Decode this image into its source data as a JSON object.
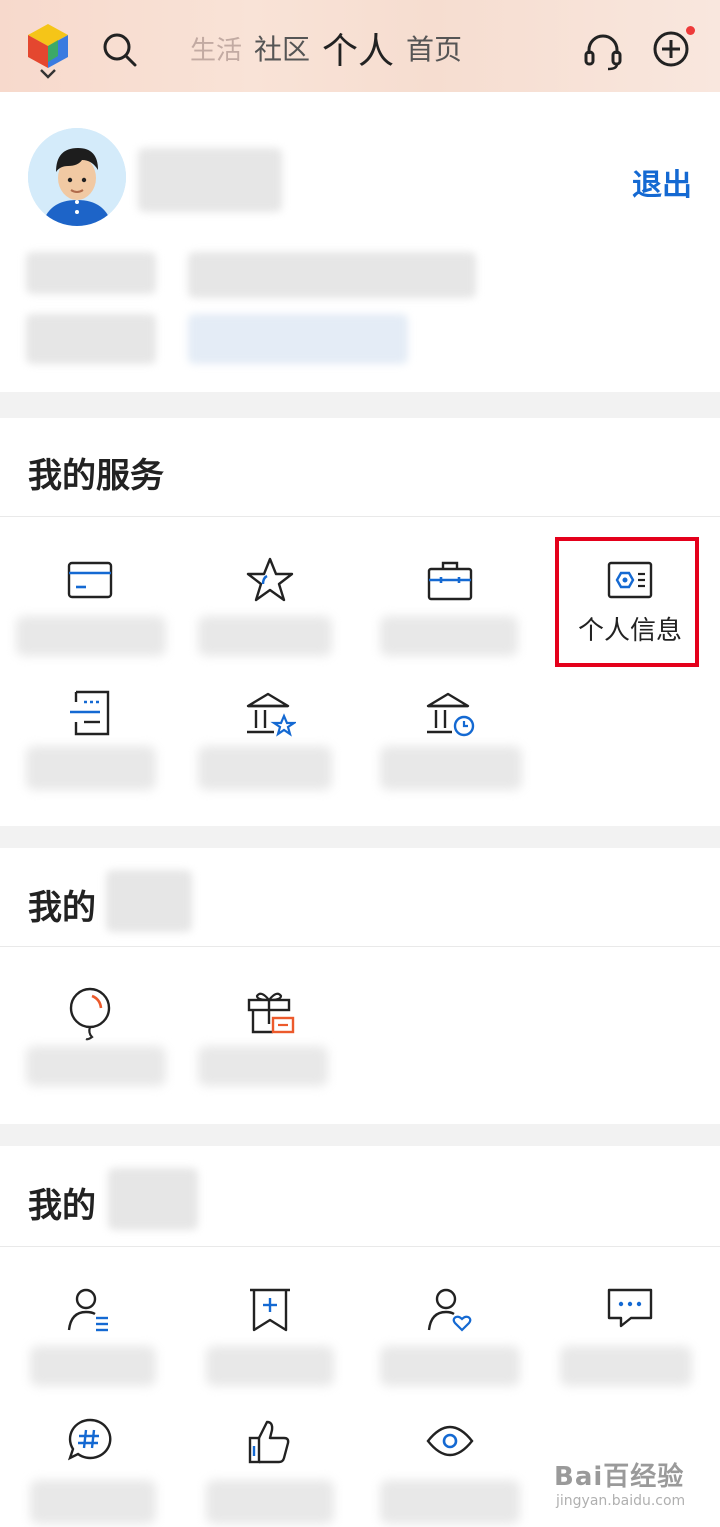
{
  "header": {
    "tabs": [
      {
        "label": "生活"
      },
      {
        "label": "社区"
      },
      {
        "label": "个人"
      },
      {
        "label": "首页"
      }
    ]
  },
  "profile": {
    "logout_label": "退出"
  },
  "my_services": {
    "title": "我的服务",
    "items": [
      {
        "icon": "card-icon",
        "label": ""
      },
      {
        "icon": "star-icon",
        "label": ""
      },
      {
        "icon": "briefcase-icon",
        "label": ""
      },
      {
        "icon": "id-card-icon",
        "label": "个人信息"
      },
      {
        "icon": "list-icon",
        "label": ""
      },
      {
        "icon": "bank-star-icon",
        "label": ""
      },
      {
        "icon": "bank-clock-icon",
        "label": ""
      }
    ]
  },
  "section2": {
    "title": "我的"
  },
  "section3": {
    "title": "我的"
  },
  "watermark": {
    "main": "Bai百经验",
    "sub": "jingyan.baidu.com"
  },
  "colors": {
    "accent": "#1469d2",
    "highlight": "#e4001b",
    "orange": "#ec5a2c"
  }
}
